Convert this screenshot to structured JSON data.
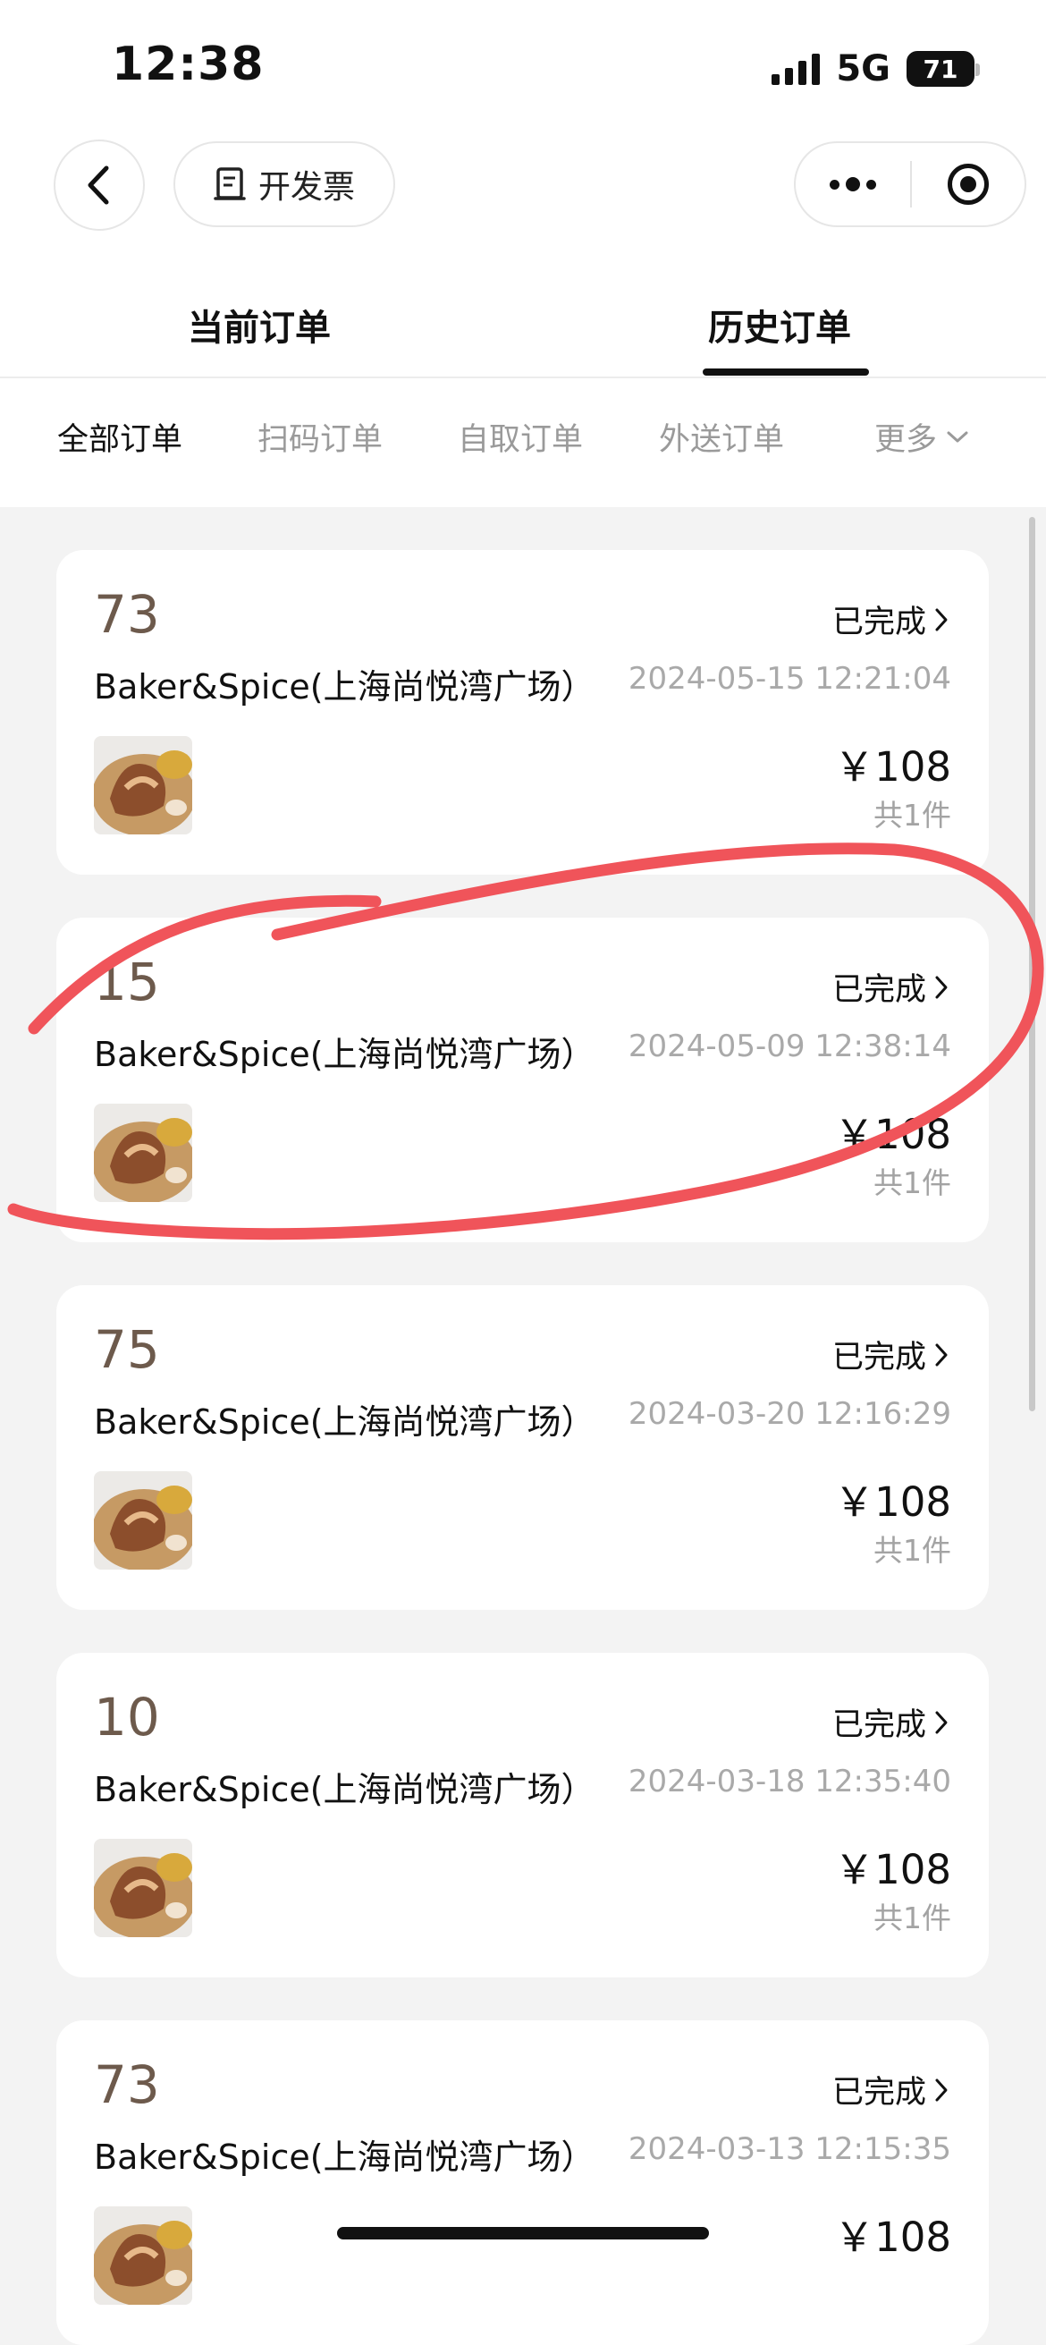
{
  "status_bar": {
    "time": "12:38",
    "network": "5G",
    "battery": "71"
  },
  "nav": {
    "invoice_label": "开发票"
  },
  "tabs": [
    {
      "label": "当前订单",
      "active": false
    },
    {
      "label": "历史订单",
      "active": true
    }
  ],
  "filters": [
    {
      "label": "全部订单",
      "active": true
    },
    {
      "label": "扫码订单",
      "active": false
    },
    {
      "label": "自取订单",
      "active": false
    },
    {
      "label": "外送订单",
      "active": false
    },
    {
      "label": "更多",
      "active": false
    }
  ],
  "orders": [
    {
      "number": "73",
      "status": "已完成",
      "store": "Baker&Spice(上海尚悦湾广场）",
      "time": "2024-05-15 12:21:04",
      "price": "￥108",
      "count": "共1件"
    },
    {
      "number": "15",
      "status": "已完成",
      "store": "Baker&Spice(上海尚悦湾广场）",
      "time": "2024-05-09 12:38:14",
      "price": "￥108",
      "count": "共1件"
    },
    {
      "number": "75",
      "status": "已完成",
      "store": "Baker&Spice(上海尚悦湾广场）",
      "time": "2024-03-20 12:16:29",
      "price": "￥108",
      "count": "共1件"
    },
    {
      "number": "10",
      "status": "已完成",
      "store": "Baker&Spice(上海尚悦湾广场）",
      "time": "2024-03-18 12:35:40",
      "price": "￥108",
      "count": "共1件"
    },
    {
      "number": "73",
      "status": "已完成",
      "store": "Baker&Spice(上海尚悦湾广场）",
      "time": "2024-03-13 12:15:35",
      "price": "￥108",
      "count": ""
    }
  ],
  "colors": {
    "order_number": "#6d5a4c",
    "annotation": "#f0545a"
  },
  "icons": [
    "back-chevron-icon",
    "invoice-icon",
    "more-dots-icon",
    "record-icon",
    "chevron-right-icon",
    "chevron-down-icon",
    "food-thumbnail"
  ]
}
